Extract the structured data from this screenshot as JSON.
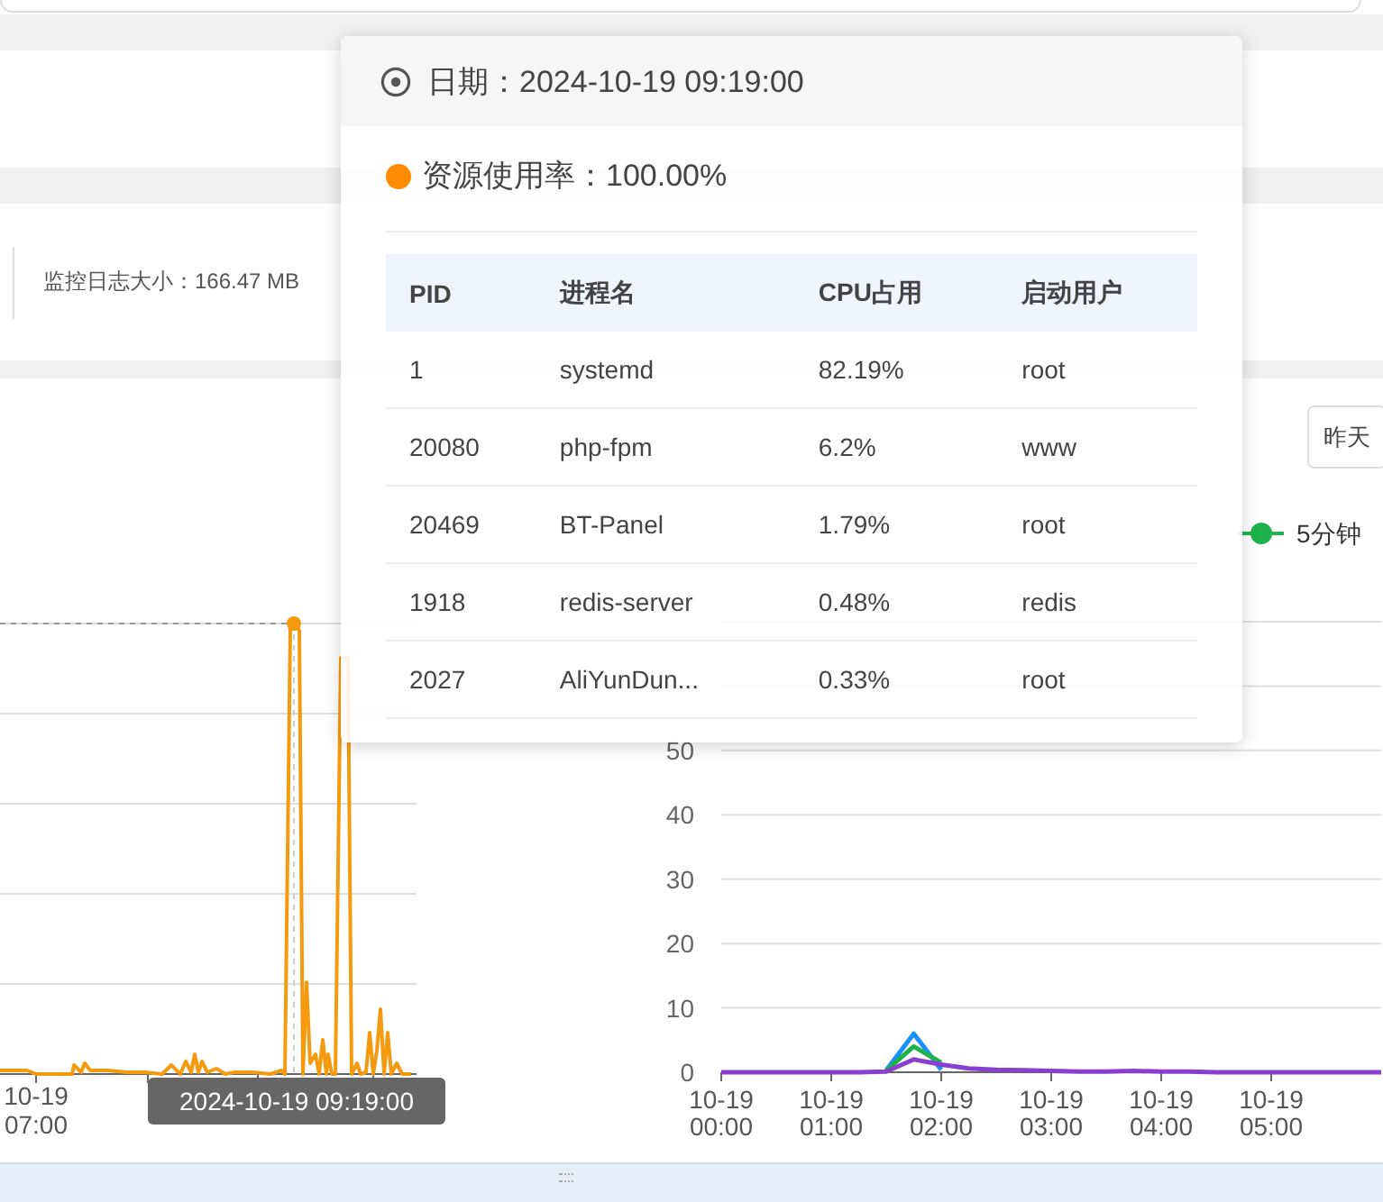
{
  "log_size": "监控日志大小：166.47 MB",
  "range_button": "昨天",
  "cpu_chart": {
    "x_label": "10-19 07:00",
    "pointer_label": "2024-10-19 09:19:00"
  },
  "load_chart": {
    "chart_data": {
      "type": "line",
      "grid": true,
      "categories": [
        "10-19 00:00",
        null,
        null,
        null,
        "10-19 01:00",
        null,
        null,
        null,
        "10-19 02:00",
        null,
        null,
        null,
        "10-19 03:00",
        null,
        null,
        null,
        "10-19 04:00",
        null,
        null,
        null,
        "10-19 05:00",
        null,
        null,
        null,
        null
      ],
      "series": [
        {
          "color": "#1890ff",
          "values": [
            null,
            null,
            null,
            null,
            null,
            null,
            0.3,
            6,
            0.4,
            null,
            null,
            null,
            null,
            null,
            null,
            null,
            null,
            null,
            null,
            null,
            null,
            null,
            null,
            null,
            null
          ]
        },
        {
          "name": "5分钟",
          "color": "#20b24a",
          "values": [
            null,
            null,
            null,
            null,
            null,
            null,
            0.3,
            4,
            1.5,
            null,
            null,
            null,
            null,
            null,
            null,
            null,
            null,
            null,
            null,
            null,
            null,
            null,
            null,
            null,
            null
          ]
        },
        {
          "color": "#8a3fd1",
          "values": [
            0,
            0,
            0,
            0,
            0,
            0,
            0.1,
            2,
            1.2,
            0.6,
            0.4,
            0.3,
            0.2,
            0.1,
            0.1,
            0.2,
            0.1,
            0.1,
            0,
            0,
            0,
            0,
            0,
            0,
            0
          ]
        }
      ],
      "ylim": [
        0,
        70
      ],
      "yticks": [
        0,
        10,
        20,
        30,
        40,
        50
      ]
    }
  },
  "tooltip": {
    "date_label": "日期：2024-10-19 09:19:00",
    "usage_label": "资源使用率：100.00%",
    "columns": [
      "PID",
      "进程名",
      "CPU占用",
      "启动用户"
    ],
    "rows": [
      [
        "1",
        "systemd",
        "82.19%",
        "root"
      ],
      [
        "20080",
        "php-fpm",
        "6.2%",
        "www"
      ],
      [
        "20469",
        "BT-Panel",
        "1.79%",
        "root"
      ],
      [
        "1918",
        "redis-server",
        "0.48%",
        "redis"
      ],
      [
        "2027",
        "AliYunDun...",
        "0.33%",
        "root"
      ]
    ]
  }
}
